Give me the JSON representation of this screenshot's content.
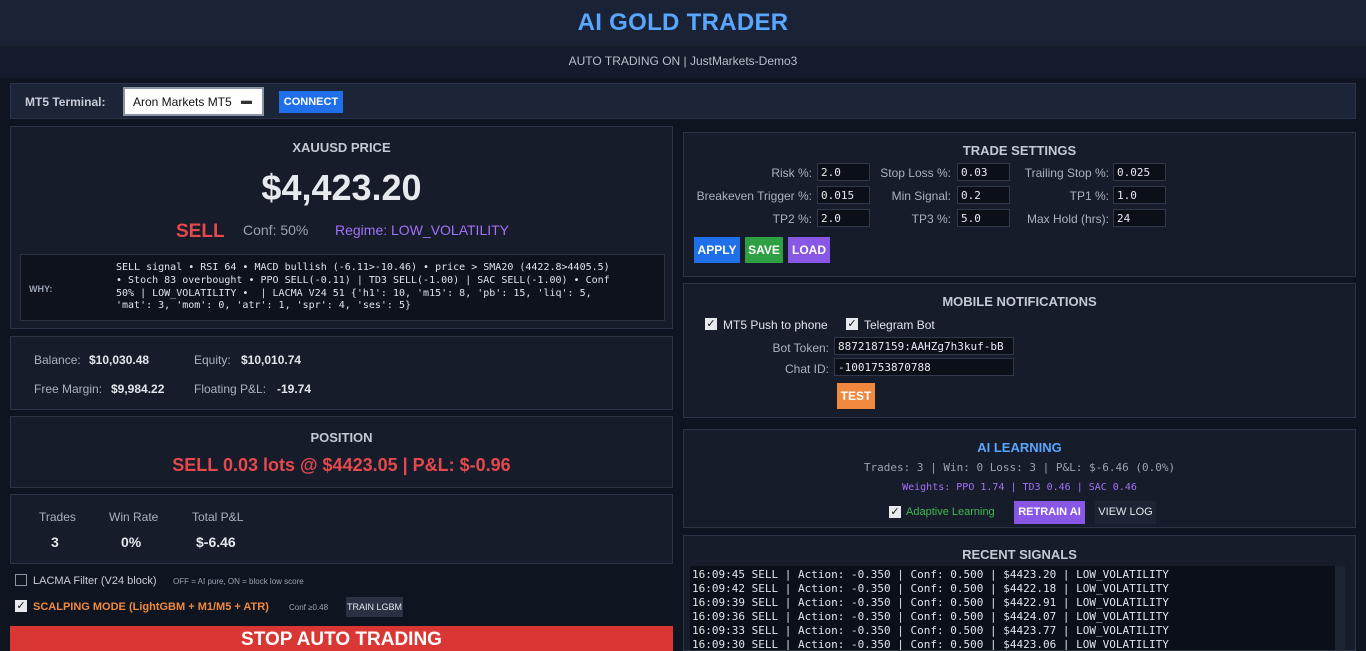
{
  "header": {
    "title": "AI GOLD TRADER",
    "status": "AUTO TRADING ON | JustMarkets-Demo3"
  },
  "terminal": {
    "label": "MT5 Terminal:",
    "selected": "Aron Markets MT5",
    "connect_label": "CONNECT"
  },
  "price": {
    "heading": "XAUUSD PRICE",
    "value": "$4,423.20",
    "signal": "SELL",
    "confidence": "Conf: 50%",
    "regime": "Regime: LOW_VOLATILITY",
    "why_label": "WHY:",
    "why_text": "SELL signal • RSI 64 • MACD bullish (-6.11>-10.46) • price > SMA20 (4422.8>4405.5)\n• Stoch 83 overbought • PPO SELL(-0.11) | TD3 SELL(-1.00) | SAC SELL(-1.00) • Conf\n50% | LOW_VOLATILITY •  | LACMA V24 51 {'h1': 10, 'm15': 8, 'pb': 15, 'liq': 5,\n'mat': 3, 'mom': 0, 'atr': 1, 'spr': 4, 'ses': 5}"
  },
  "account": {
    "balance_label": "Balance:",
    "balance": "$10,030.48",
    "equity_label": "Equity:",
    "equity": "$10,010.74",
    "free_margin_label": "Free Margin:",
    "free_margin": "$9,984.22",
    "floating_label": "Floating P&L:",
    "floating": "-19.74"
  },
  "position": {
    "heading": "POSITION",
    "text": "SELL 0.03 lots @ $4423.05 | P&L: $-0.96"
  },
  "stats": {
    "trades_label": "Trades",
    "trades": "3",
    "winrate_label": "Win Rate",
    "winrate": "0%",
    "pnl_label": "Total P&L",
    "pnl": "$-6.46"
  },
  "filters": {
    "lacma_label": "LACMA Filter (V24 block)",
    "lacma_checked": false,
    "lacma_note": "OFF = AI pure, ON = block low score",
    "scalping_label": "SCALPING MODE (LightGBM + M1/M5 + ATR)",
    "scalping_checked": true,
    "scalping_note": "Conf ≥0.48",
    "train_label": "TRAIN LGBM"
  },
  "stop_label": "STOP AUTO TRADING",
  "settings": {
    "heading": "TRADE SETTINGS",
    "fields": [
      {
        "label": "Risk %:",
        "value": "2.0"
      },
      {
        "label": "Stop Loss %:",
        "value": "0.03"
      },
      {
        "label": "Trailing Stop %:",
        "value": "0.025"
      },
      {
        "label": "Breakeven Trigger %:",
        "value": "0.015"
      },
      {
        "label": "Min Signal:",
        "value": "0.2"
      },
      {
        "label": "TP1 %:",
        "value": "1.0"
      },
      {
        "label": "TP2 %:",
        "value": "2.0"
      },
      {
        "label": "TP3 %:",
        "value": "5.0"
      },
      {
        "label": "Max Hold (hrs):",
        "value": "24"
      }
    ],
    "apply_label": "APPLY",
    "save_label": "SAVE",
    "load_label": "LOAD"
  },
  "mobile": {
    "heading": "MOBILE NOTIFICATIONS",
    "mt5_push_label": "MT5 Push to phone",
    "mt5_push_checked": true,
    "telegram_label": "Telegram Bot",
    "telegram_checked": true,
    "bot_token_label": "Bot Token:",
    "bot_token": "8872187159:AAHZg7h3kuf-bB",
    "chat_id_label": "Chat ID:",
    "chat_id": "-1001753870788",
    "test_label": "TEST"
  },
  "ai": {
    "heading": "AI LEARNING",
    "stats": "Trades: 3 | Win: 0 Loss: 3 | P&L: $-6.46 (0.0%)",
    "weights": "Weights: PPO 1.74 | TD3 0.46 | SAC 0.46",
    "adaptive_label": "Adaptive Learning",
    "adaptive_checked": true,
    "retrain_label": "RETRAIN AI",
    "log_label": "VIEW LOG"
  },
  "signals": {
    "heading": "RECENT SIGNALS",
    "lines": [
      "16:09:45 SELL | Action: -0.350 | Conf: 0.500 | $4423.20 | LOW_VOLATILITY",
      "16:09:42 SELL | Action: -0.350 | Conf: 0.500 | $4422.18 | LOW_VOLATILITY",
      "16:09:39 SELL | Action: -0.350 | Conf: 0.500 | $4422.91 | LOW_VOLATILITY",
      "16:09:36 SELL | Action: -0.350 | Conf: 0.500 | $4424.07 | LOW_VOLATILITY",
      "16:09:33 SELL | Action: -0.350 | Conf: 0.500 | $4423.77 | LOW_VOLATILITY",
      "16:09:30 SELL | Action: -0.350 | Conf: 0.500 | $4423.06 | LOW_VOLATILITY"
    ]
  },
  "colors": {
    "accent": "#58a6ff",
    "sell": "#e5484d",
    "regime": "#a371f7",
    "connect": "#1f6feb",
    "save": "#2ea043",
    "load": "#8957e5",
    "test": "#f0883e",
    "stop": "#da3633"
  }
}
